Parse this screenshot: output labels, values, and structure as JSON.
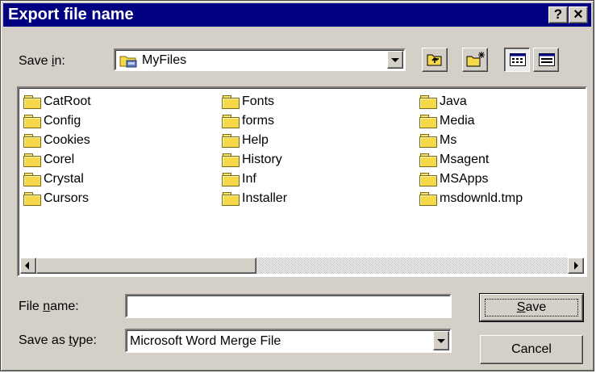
{
  "window": {
    "title": "Export file name",
    "help_btn": "?",
    "close_btn": "×"
  },
  "toolbar": {
    "save_in_label_pre": "Save ",
    "save_in_label_key": "i",
    "save_in_label_post": "n:",
    "save_in_value": "MyFiles",
    "up_icon": "up-one-level-icon",
    "new_folder_icon": "new-folder-icon",
    "list_icon": "list-view-icon",
    "details_icon": "details-view-icon"
  },
  "files": {
    "col1": [
      "CatRoot",
      "Config",
      "Cookies",
      "Corel",
      "Crystal",
      "Cursors"
    ],
    "col2": [
      "Fonts",
      "forms",
      "Help",
      "History",
      "Inf",
      "Installer"
    ],
    "col3": [
      "Java",
      "Media",
      "Ms",
      "Msagent",
      "MSApps",
      "msdownld.tmp"
    ]
  },
  "form": {
    "file_name_label_pre": "File ",
    "file_name_label_key": "n",
    "file_name_label_post": "ame:",
    "file_name_value": "",
    "save_type_label_pre": "Save as ",
    "save_type_label_key": "t",
    "save_type_label_post": "ype:",
    "save_type_value": "Microsoft Word Merge File"
  },
  "buttons": {
    "save_key": "S",
    "save_rest": "ave",
    "cancel": "Cancel"
  },
  "colors": {
    "title_bar": "#000080",
    "face": "#d4d0c8",
    "folder": "#f5d94a"
  }
}
